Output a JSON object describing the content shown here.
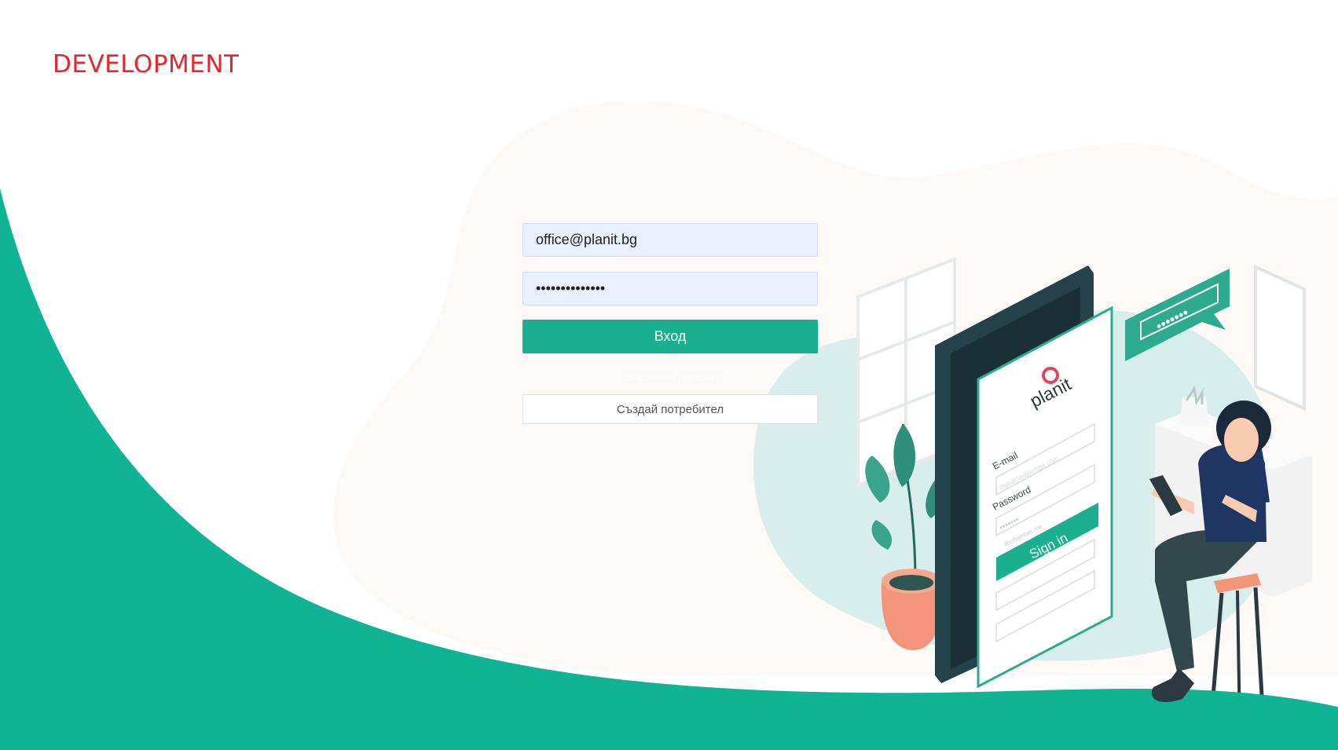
{
  "header": {
    "env_label": "DEVELOPMENT"
  },
  "login": {
    "email_value": "office@planit.bg",
    "password_value": "••••••••••••••",
    "submit_label": "Вход",
    "forgot_password": "Забравена парола?",
    "create_user_label": "Създай потребител"
  },
  "illustration": {
    "app_name": "planit",
    "email_label": "E-mail",
    "email_placeholder": "myname@email.com",
    "password_label": "Password",
    "password_dots": "•••••••",
    "remember_label": "Remember me",
    "sign_in_label": "Sign in",
    "bubble_dots": "•••••••"
  },
  "colors": {
    "brand_green": "#10b394",
    "button_green": "#1aaf8e",
    "env_red": "#e8262e",
    "input_fill": "#e8f0fe"
  }
}
